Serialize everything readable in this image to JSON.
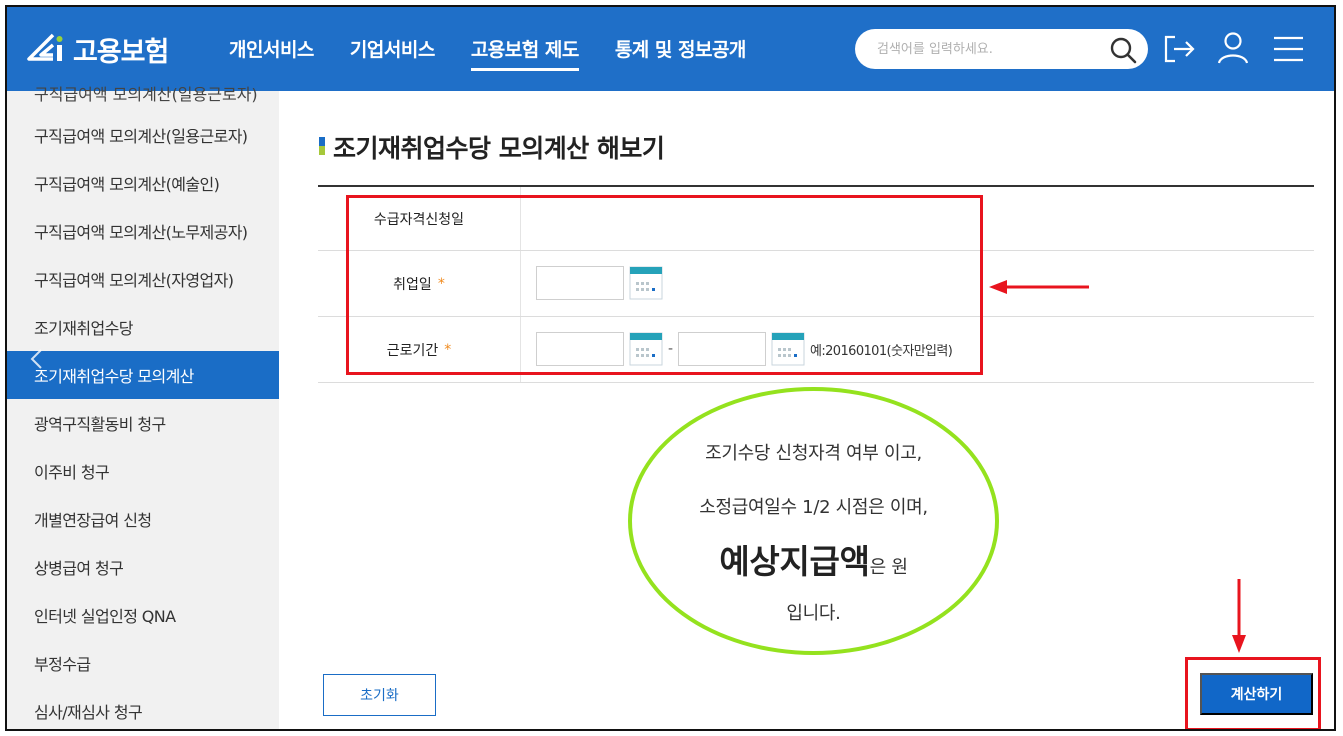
{
  "header": {
    "logo_text": "고용보험",
    "nav": [
      "개인서비스",
      "기업서비스",
      "고용보험 제도",
      "통계 및 정보공개"
    ],
    "active_nav_index": 2,
    "search_placeholder": "검색어를 입력하세요.",
    "icons": [
      "search-icon",
      "logout-icon",
      "user-icon",
      "menu-icon"
    ],
    "bg_color": "#1f6fc8"
  },
  "sidebar": {
    "clipped_item": "구직급여액 모의계산(일용근로자)",
    "items": [
      "구직급여액 모의계산(일용근로자)",
      "구직급여액 모의계산(예술인)",
      "구직급여액 모의계산(노무제공자)",
      "구직급여액 모의계산(자영업자)",
      "조기재취업수당",
      "조기재취업수당 모의계산",
      "광역구직활동비 청구",
      "이주비 청구",
      "개별연장급여 신청",
      "상병급여 청구",
      "인터넷 실업인정 QNA",
      "부정수급",
      "심사/재심사 청구"
    ],
    "active_index": 5,
    "active_color": "#1a6dc6"
  },
  "main": {
    "title": "조기재취업수당 모의계산 해보기",
    "form": {
      "apply_date_label": "수급자격신청일",
      "employ_date_label": "취업일",
      "work_period_label": "근로기간",
      "required_mark": "*",
      "period_separator": "-",
      "hint": "예:20160101(숫자만입력)"
    },
    "result": {
      "line1": "조기수당 신청자격 여부 이고,",
      "line2": "소정급여일수 1/2 시점은 이며,",
      "strong": "예상지급액",
      "line3_suffix": "은 원",
      "line4": "입니다."
    },
    "buttons": {
      "reset": "초기화",
      "calculate": "계산하기"
    }
  },
  "annotation_color": "#e8141e",
  "highlight_color": "#94e21e"
}
